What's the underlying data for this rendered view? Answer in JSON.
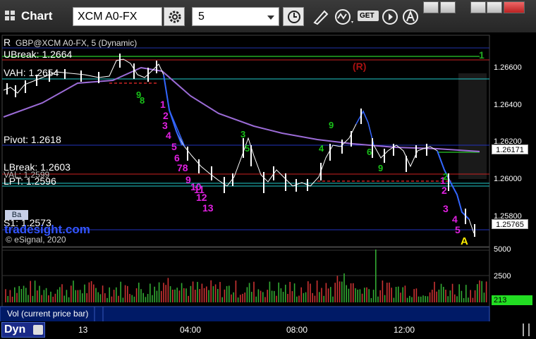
{
  "window": {
    "title": "Chart"
  },
  "toolbar": {
    "symbol": "XCM A0-FX",
    "interval": "5",
    "get_label": "GET"
  },
  "chart": {
    "header_text": "GBP@XCM A0-FX, 5 (Dynamic)",
    "watermark": "tradesight.com",
    "copyright": "© eSignal, 2020",
    "r_label": "(R)",
    "a_label": "A",
    "level_labels": {
      "r": "R",
      "ubreak": "UBreak: 1.2664",
      "vah": "VAH: 1.2654",
      "pivot": "Pivot: 1.2618",
      "lbreak": "LBreak: 1.2603",
      "val": "VAL: 1.2599",
      "lpt": "LPT: 1.2596",
      "s1": "S1: 1.2573"
    },
    "price_axis": [
      "1.26600",
      "1.26400",
      "1.26200",
      "1.26000",
      "1.25800"
    ],
    "price_tags": {
      "ma": "1.26171",
      "last": "1.25765"
    },
    "seq_labels": [
      "1",
      "2",
      "3",
      "4",
      "5",
      "6",
      "78",
      "9",
      "10",
      "11",
      "12",
      "13",
      "1",
      "2",
      "3",
      "4",
      "5"
    ],
    "green_counts": [
      "1",
      "2",
      "3",
      "4",
      "5",
      "6",
      "7",
      "8",
      "9"
    ],
    "green_one": "1",
    "ys_btn": "Ba"
  },
  "volume": {
    "label": "Vol (current price bar)",
    "axis": [
      "5000",
      "2500"
    ],
    "current": "213"
  },
  "time_axis": {
    "labels": [
      "13",
      "04:00",
      "08:00",
      "12:00"
    ]
  },
  "bottom": {
    "dyn": "Dyn"
  }
}
